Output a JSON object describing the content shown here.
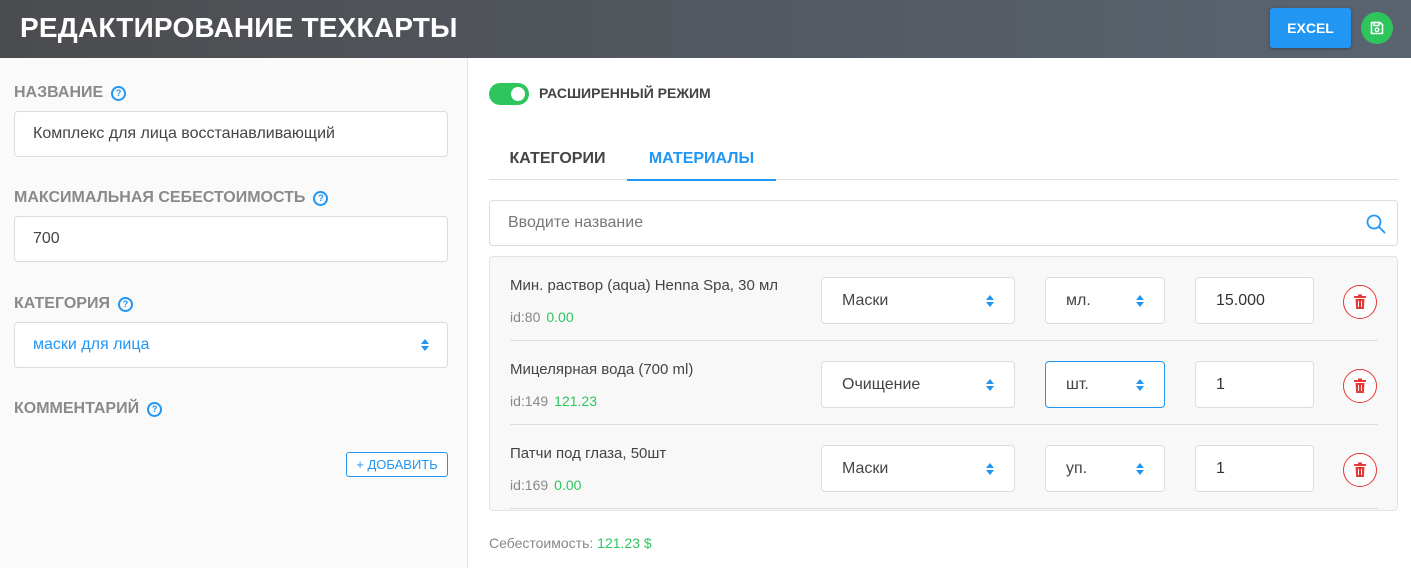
{
  "header": {
    "title": "РЕДАКТИРОВАНИЕ ТЕХКАРТЫ",
    "excel_label": "EXCEL",
    "save_icon": "save-icon",
    "colors": {
      "excel": "#2196f3",
      "save": "#2ec55d"
    }
  },
  "left": {
    "name": {
      "label": "НАЗВАНИЕ",
      "value": "Комплекс для лица восстанавливающий"
    },
    "max_cost": {
      "label": "МАКСИМАЛЬНАЯ СЕБЕСТОИМОСТЬ",
      "value": "700"
    },
    "category": {
      "label": "КАТЕГОРИЯ",
      "value": "маски для лица"
    },
    "comment": {
      "label": "КОММЕНТАРИЙ"
    },
    "add_label": "+ ДОБАВИТЬ"
  },
  "right": {
    "mode_label": "РАСШИРЕННЫЙ РЕЖИМ",
    "mode_on": true,
    "tabs": [
      {
        "label": "КАТЕГОРИИ"
      },
      {
        "label": "МАТЕРИАЛЫ",
        "active": true
      }
    ],
    "search": {
      "placeholder": "Вводите название",
      "value": ""
    },
    "materials": [
      {
        "name": "Мин. раствор (aqua) Henna Spa, 30 мл",
        "id": "id:80",
        "cost": "0.00",
        "category": "Маски",
        "unit": "мл.",
        "qty": "15.000"
      },
      {
        "name": "Мицелярная вода (700 ml)",
        "id": "id:149",
        "cost": "121.23",
        "category": "Очищение",
        "unit": "шт.",
        "qty": "1"
      },
      {
        "name": "Патчи под глаза, 50шт",
        "id": "id:169",
        "cost": "0.00",
        "category": "Маски",
        "unit": "уп.",
        "qty": "1"
      }
    ],
    "summary": {
      "label": "Себестоимость:",
      "value": "121.23 $"
    }
  }
}
